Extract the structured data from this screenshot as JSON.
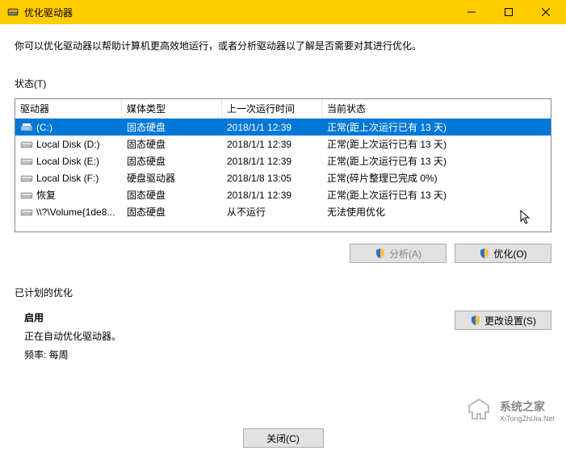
{
  "window": {
    "title": "优化驱动器"
  },
  "description": "你可以优化驱动器以帮助计算机更高效地运行，或者分析驱动器以了解是否需要对其进行优化。",
  "statusLabel": "状态(T)",
  "columns": {
    "drive": "驱动器",
    "media": "媒体类型",
    "lastrun": "上一次运行时间",
    "status": "当前状态"
  },
  "rows": [
    {
      "drive": "(C:)",
      "media": "固态硬盘",
      "lastrun": "2018/1/1 12:39",
      "status": "正常(距上次运行已有 13 天)",
      "selected": true,
      "iconType": "os"
    },
    {
      "drive": "Local Disk (D:)",
      "media": "固态硬盘",
      "lastrun": "2018/1/1 12:39",
      "status": "正常(距上次运行已有 13 天)",
      "selected": false,
      "iconType": "hdd"
    },
    {
      "drive": "Local Disk (E:)",
      "media": "固态硬盘",
      "lastrun": "2018/1/1 12:39",
      "status": "正常(距上次运行已有 13 天)",
      "selected": false,
      "iconType": "hdd"
    },
    {
      "drive": "Local Disk (F:)",
      "media": "硬盘驱动器",
      "lastrun": "2018/1/8 13:05",
      "status": "正常(碎片整理已完成 0%)",
      "selected": false,
      "iconType": "hdd"
    },
    {
      "drive": "恢复",
      "media": "固态硬盘",
      "lastrun": "2018/1/1 12:39",
      "status": "正常(距上次运行已有 13 天)",
      "selected": false,
      "iconType": "hdd"
    },
    {
      "drive": "\\\\?\\Volume{1de8...",
      "media": "固态硬盘",
      "lastrun": "从不运行",
      "status": "无法使用优化",
      "selected": false,
      "iconType": "hdd"
    }
  ],
  "buttons": {
    "analyze": "分析(A)",
    "optimize": "优化(O)",
    "changeSettings": "更改设置(S)",
    "close": "关闭(C)"
  },
  "schedule": {
    "sectionLabel": "已计划的优化",
    "status": "启用",
    "detail": "正在自动优化驱动器。",
    "frequency": "频率: 每周"
  },
  "watermark": {
    "text": "系统之家",
    "sub": "XiTongZhiJia.Net"
  }
}
